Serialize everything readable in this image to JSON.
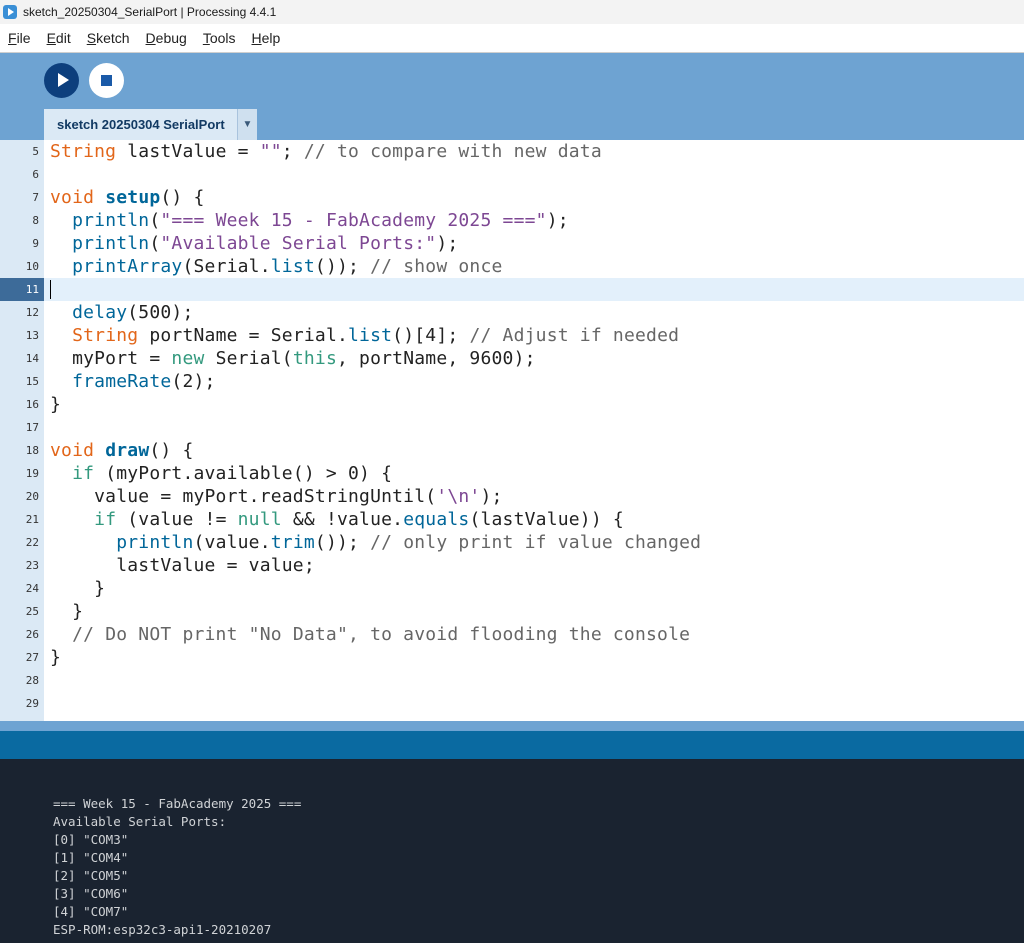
{
  "window": {
    "title": "sketch_20250304_SerialPort | Processing 4.4.1"
  },
  "menu": [
    {
      "mnemonic": "F",
      "rest": "ile"
    },
    {
      "mnemonic": "E",
      "rest": "dit"
    },
    {
      "mnemonic": "S",
      "rest": "ketch"
    },
    {
      "mnemonic": "D",
      "rest": "ebug"
    },
    {
      "mnemonic": "T",
      "rest": "ools"
    },
    {
      "mnemonic": "H",
      "rest": "elp"
    }
  ],
  "toolbar": {
    "run_icon": "play-icon",
    "stop_icon": "stop-icon"
  },
  "tab": {
    "label": "sketch 20250304 SerialPort",
    "menu_glyph": "▼"
  },
  "editor": {
    "active_line": "11",
    "lines": [
      {
        "n": "5",
        "tokens": [
          [
            "String",
            "type"
          ],
          [
            " lastValue = ",
            ""
          ],
          [
            "\"\"",
            "str"
          ],
          [
            "; ",
            ""
          ],
          [
            "// to compare with new data",
            "cm"
          ]
        ]
      },
      {
        "n": "6",
        "tokens": []
      },
      {
        "n": "7",
        "tokens": [
          [
            "void",
            "type"
          ],
          [
            " ",
            ""
          ],
          [
            "setup",
            "fnb"
          ],
          [
            "() {",
            ""
          ]
        ]
      },
      {
        "n": "8",
        "tokens": [
          [
            "  ",
            ""
          ],
          [
            "println",
            "fn"
          ],
          [
            "(",
            ""
          ],
          [
            "\"=== Week 15 - FabAcademy 2025 ===\"",
            "str"
          ],
          [
            ");",
            ""
          ]
        ]
      },
      {
        "n": "9",
        "tokens": [
          [
            "  ",
            ""
          ],
          [
            "println",
            "fn"
          ],
          [
            "(",
            ""
          ],
          [
            "\"Available Serial Ports:\"",
            "str"
          ],
          [
            ");",
            ""
          ]
        ]
      },
      {
        "n": "10",
        "tokens": [
          [
            "  ",
            ""
          ],
          [
            "printArray",
            "fn"
          ],
          [
            "(Serial.",
            ""
          ],
          [
            "list",
            "fn"
          ],
          [
            "()); ",
            ""
          ],
          [
            "// show once",
            "cm"
          ]
        ]
      },
      {
        "n": "11",
        "tokens": []
      },
      {
        "n": "12",
        "tokens": [
          [
            "  ",
            ""
          ],
          [
            "delay",
            "fn"
          ],
          [
            "(500);",
            ""
          ]
        ]
      },
      {
        "n": "13",
        "tokens": [
          [
            "  ",
            ""
          ],
          [
            "String",
            "type"
          ],
          [
            " portName = Serial.",
            ""
          ],
          [
            "list",
            "fn"
          ],
          [
            "()[4]; ",
            ""
          ],
          [
            "// Adjust if needed",
            "cm"
          ]
        ]
      },
      {
        "n": "14",
        "tokens": [
          [
            "  myPort = ",
            ""
          ],
          [
            "new",
            "kw"
          ],
          [
            " Serial(",
            ""
          ],
          [
            "this",
            "kw"
          ],
          [
            ", portName, 9600);",
            ""
          ]
        ]
      },
      {
        "n": "15",
        "tokens": [
          [
            "  ",
            ""
          ],
          [
            "frameRate",
            "fn"
          ],
          [
            "(2);",
            ""
          ]
        ]
      },
      {
        "n": "16",
        "tokens": [
          [
            "}",
            ""
          ]
        ]
      },
      {
        "n": "17",
        "tokens": []
      },
      {
        "n": "18",
        "tokens": [
          [
            "void",
            "type"
          ],
          [
            " ",
            ""
          ],
          [
            "draw",
            "fnb"
          ],
          [
            "() {",
            ""
          ]
        ]
      },
      {
        "n": "19",
        "tokens": [
          [
            "  ",
            ""
          ],
          [
            "if",
            "kw"
          ],
          [
            " (myPort.available() > 0) {",
            ""
          ]
        ]
      },
      {
        "n": "20",
        "tokens": [
          [
            "    value = myPort.readStringUntil(",
            ""
          ],
          [
            "'\\n'",
            "str"
          ],
          [
            ");",
            ""
          ]
        ]
      },
      {
        "n": "21",
        "tokens": [
          [
            "    ",
            ""
          ],
          [
            "if",
            "kw"
          ],
          [
            " (value != ",
            ""
          ],
          [
            "null",
            "kw"
          ],
          [
            " && !value.",
            ""
          ],
          [
            "equals",
            "fn"
          ],
          [
            "(lastValue)) {",
            ""
          ]
        ]
      },
      {
        "n": "22",
        "tokens": [
          [
            "      ",
            ""
          ],
          [
            "println",
            "fn"
          ],
          [
            "(value.",
            ""
          ],
          [
            "trim",
            "fn"
          ],
          [
            "()); ",
            ""
          ],
          [
            "// only print if value changed",
            "cm"
          ]
        ]
      },
      {
        "n": "23",
        "tokens": [
          [
            "      lastValue = value;",
            ""
          ]
        ]
      },
      {
        "n": "24",
        "tokens": [
          [
            "    }",
            ""
          ]
        ]
      },
      {
        "n": "25",
        "tokens": [
          [
            "  }",
            ""
          ]
        ]
      },
      {
        "n": "26",
        "tokens": [
          [
            "  ",
            ""
          ],
          [
            "// Do NOT print \"No Data\", to avoid flooding the console",
            "cm"
          ]
        ]
      },
      {
        "n": "27",
        "tokens": [
          [
            "}",
            ""
          ]
        ]
      },
      {
        "n": "28",
        "tokens": []
      },
      {
        "n": "29",
        "tokens": []
      }
    ]
  },
  "console": {
    "lines": [
      "=== Week 15 - FabAcademy 2025 ===",
      "Available Serial Ports:",
      "[0] \"COM3\"",
      "[1] \"COM4\"",
      "[2] \"COM5\"",
      "[3] \"COM6\"",
      "[4] \"COM7\"",
      "ESP-ROM:esp32c3-api1-20210207"
    ]
  }
}
